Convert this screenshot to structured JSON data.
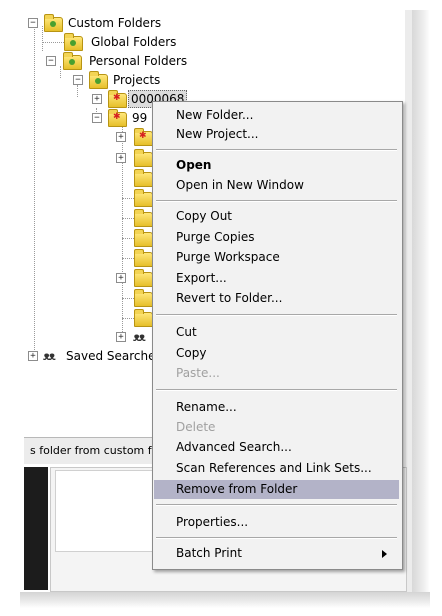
{
  "tree": {
    "custom_folders": "Custom Folders",
    "global_folders": "Global Folders",
    "personal_folders": "Personal Folders",
    "projects": "Projects",
    "item_a": "0000068",
    "item_b": "99",
    "saved_searches": "Saved Searche"
  },
  "status": {
    "text": "s folder from custom fol"
  },
  "context_menu": {
    "new_folder": "New Folder...",
    "new_project": "New Project...",
    "open": "Open",
    "open_new_window": "Open in New Window",
    "copy_out": "Copy Out",
    "purge_copies": "Purge Copies",
    "purge_workspace": "Purge Workspace",
    "export": "Export...",
    "revert_to_folder": "Revert to Folder...",
    "cut": "Cut",
    "copy": "Copy",
    "paste": "Paste...",
    "rename": "Rename...",
    "delete": "Delete",
    "advanced_search": "Advanced Search...",
    "scan_references": "Scan References and Link Sets...",
    "remove_from_folder": "Remove from Folder",
    "properties": "Properties...",
    "batch_print": "Batch Print"
  },
  "icons": {
    "expand": "plus-box-icon",
    "collapse": "minus-box-icon",
    "folder": "folder-icon",
    "project": "project-folder-icon",
    "saved_search": "binoculars-icon",
    "submenu": "submenu-arrow-icon"
  },
  "colors": {
    "menu_bg": "#f2f2f2",
    "menu_highlight": "#b3b3c8",
    "folder_yellow": "#f3d454",
    "disabled_text": "#a0a0a0"
  }
}
